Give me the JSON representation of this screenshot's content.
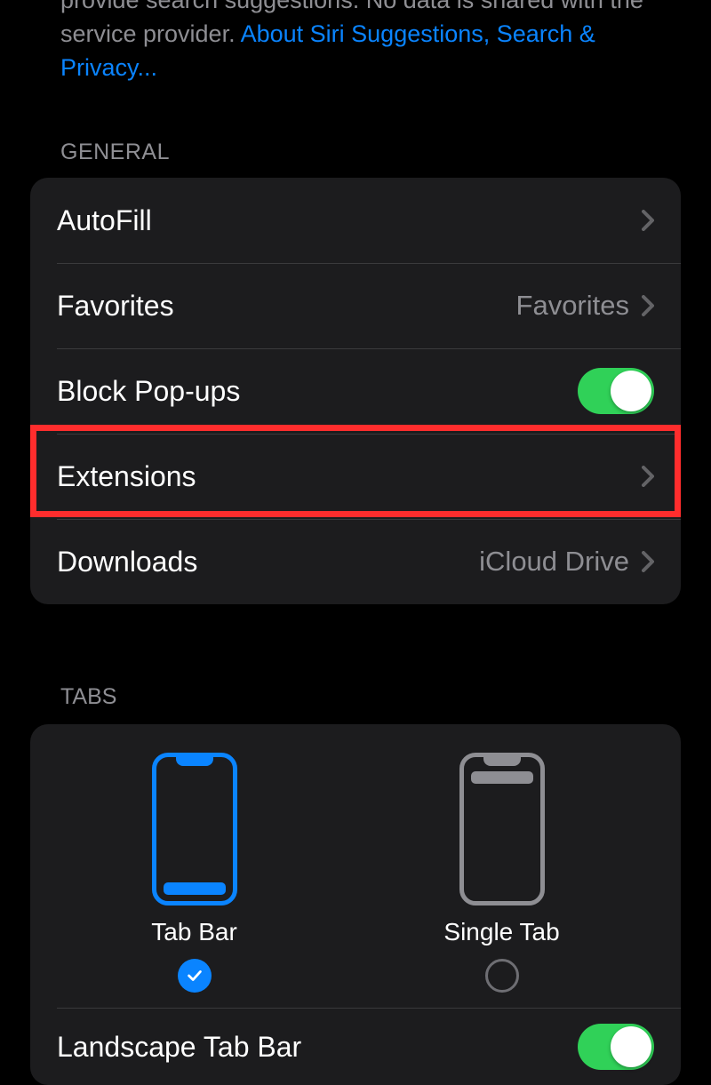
{
  "top_description": {
    "line1_partial": "provide search suggestions. No data is shared with",
    "line2_prefix": "the service provider. ",
    "link": "About Siri Suggestions, Search & Privacy..."
  },
  "section_general_header": "General",
  "general": {
    "autofill": {
      "label": "AutoFill"
    },
    "favorites": {
      "label": "Favorites",
      "value": "Favorites"
    },
    "block_popups": {
      "label": "Block Pop-ups",
      "on": true
    },
    "extensions": {
      "label": "Extensions"
    },
    "downloads": {
      "label": "Downloads",
      "value": "iCloud Drive"
    }
  },
  "section_tabs_header": "Tabs",
  "tabs": {
    "option_tabbar": {
      "label": "Tab Bar",
      "selected": true
    },
    "option_singletab": {
      "label": "Single Tab",
      "selected": false
    },
    "landscape": {
      "label": "Landscape Tab Bar",
      "on": true
    }
  }
}
